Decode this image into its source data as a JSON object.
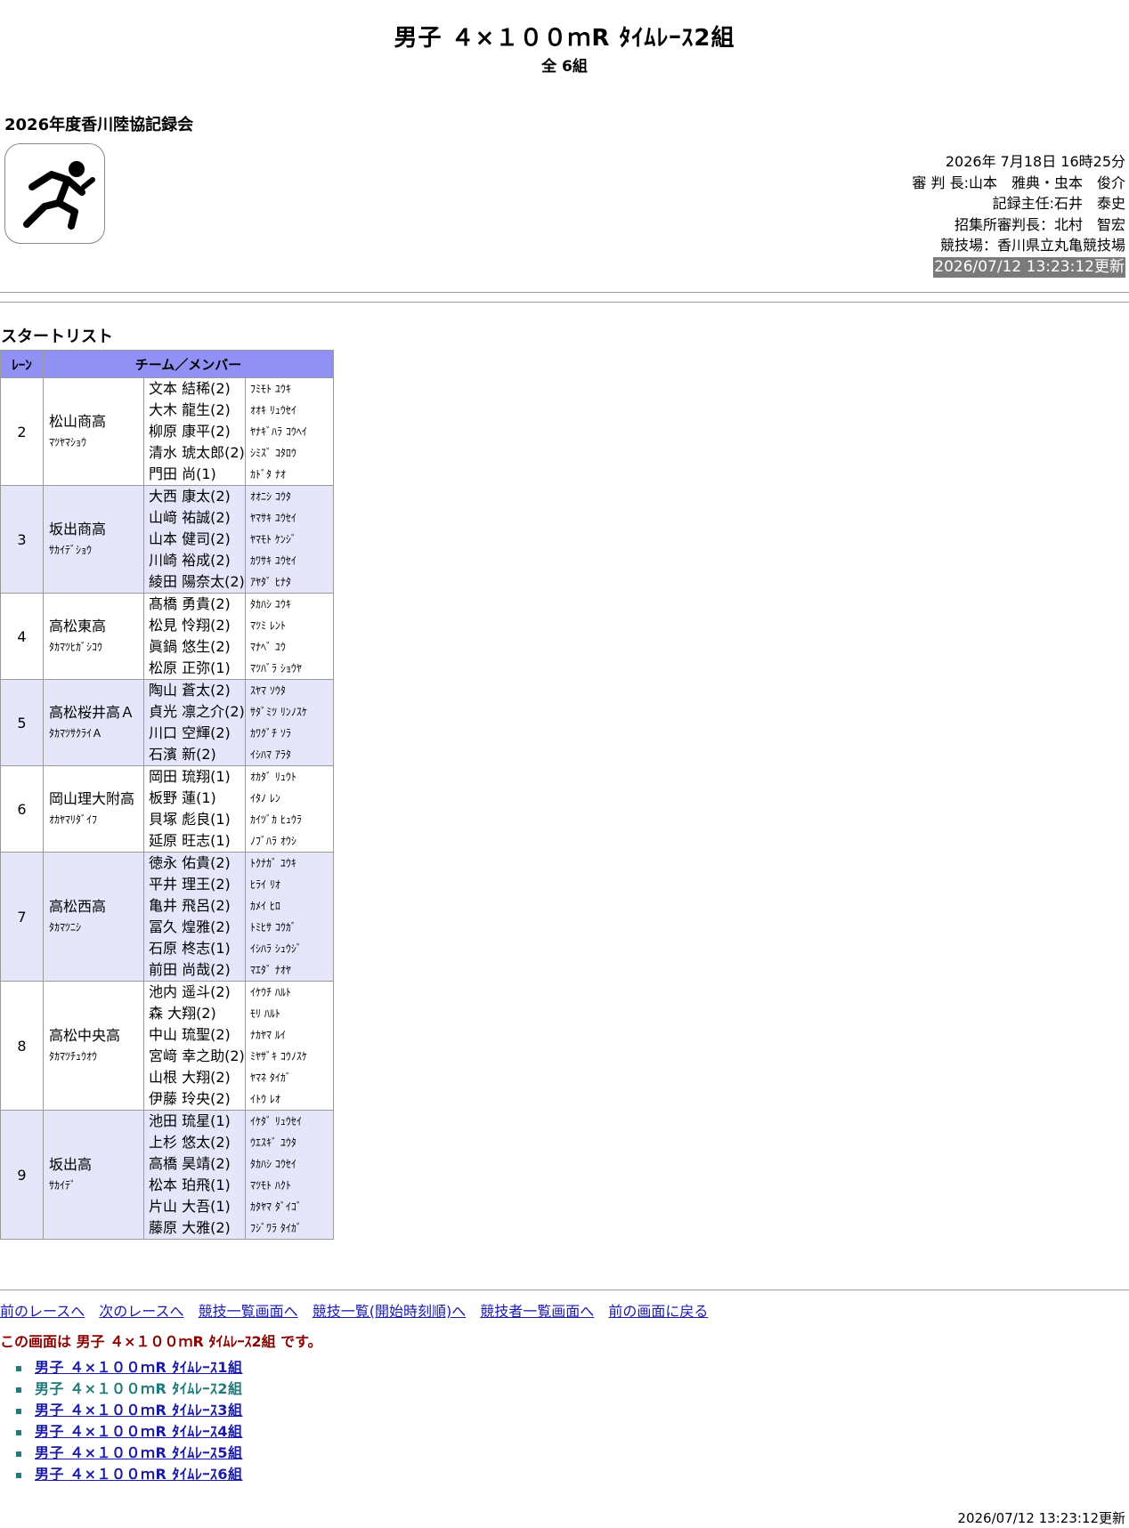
{
  "header": {
    "title": "男子 ４×１００ｍR ﾀｲﾑﾚｰｽ2組",
    "subtitle": "全 6組",
    "meet_name": "2026年度香川陸協記録会",
    "logo_icon": "runner-icon"
  },
  "info": {
    "datetime": "2026年 7月18日 16時25分",
    "referee": "審 判 長:山本　雅典・虫本　俊介",
    "recorder": "記録主任:石井　泰史",
    "call_room": "招集所審判長：北村　智宏",
    "venue": "競技場：香川県立丸亀競技場",
    "updated": "2026/07/12 13:23:12更新"
  },
  "section_title": "スタートリスト",
  "table": {
    "headers": [
      "ﾚｰﾝ",
      "チーム／メンバー"
    ],
    "rows": [
      {
        "lane": "2",
        "team": "松山商高",
        "team_kana": "ﾏﾂﾔﾏｼｮｳ",
        "members": [
          "文本 結稀(2)",
          "大木 龍生(2)",
          "柳原 康平(2)",
          "清水 琥太郎(2)",
          "門田 尚(1)"
        ],
        "kanas": [
          "ﾌﾐﾓﾄ ﾕｳｷ",
          "ｵｵｷ ﾘｭｳｾｲ",
          "ﾔﾅｷﾞﾊﾗ ｺｳﾍｲ",
          "ｼﾐｽﾞ ｺﾀﾛｳ",
          "ｶﾄﾞﾀ ﾅｵ"
        ]
      },
      {
        "lane": "3",
        "team": "坂出商高",
        "team_kana": "ｻｶｲﾃﾞｼｮｳ",
        "members": [
          "大西 康太(2)",
          "山﨑 祐誠(2)",
          "山本 健司(2)",
          "川崎 裕成(2)",
          "綾田 陽奈太(2)"
        ],
        "kanas": [
          "ｵｵﾆｼ ｺｳﾀ",
          "ﾔﾏｻｷ ﾕｳｾｲ",
          "ﾔﾏﾓﾄ ｹﾝｼﾞ",
          "ｶﾜｻｷ ﾕｳｾｲ",
          "ｱﾔﾀﾞ ﾋﾅﾀ"
        ]
      },
      {
        "lane": "4",
        "team": "高松東高",
        "team_kana": "ﾀｶﾏﾂﾋｶﾞｼｺｳ",
        "members": [
          "髙橋 勇貴(2)",
          "松見 怜翔(2)",
          "眞鍋 悠生(2)",
          "松原 正弥(1)"
        ],
        "kanas": [
          "ﾀｶﾊｼ ﾕｳｷ",
          "ﾏﾂﾐ ﾚﾝﾄ",
          "ﾏﾅﾍﾞ ﾕｳ",
          "ﾏﾂﾊﾞﾗ ｼｮｳﾔ"
        ]
      },
      {
        "lane": "5",
        "team": "高松桜井高Ａ",
        "team_kana": "ﾀｶﾏﾂｻｸﾗｲＡ",
        "members": [
          "陶山 蒼太(2)",
          "貞光 凛之介(2)",
          "川口 空輝(2)",
          "石濱 新(2)"
        ],
        "kanas": [
          "ｽﾔﾏ ｿｳﾀ",
          "ｻﾀﾞﾐﾂ ﾘﾝﾉｽｹ",
          "ｶﾜｸﾞﾁ ｿﾗ",
          "ｲｼﾊﾏ ｱﾗﾀ"
        ]
      },
      {
        "lane": "6",
        "team": "岡山理大附高",
        "team_kana": "ｵｶﾔﾏﾘﾀﾞｲﾌ",
        "members": [
          "岡田 琉翔(1)",
          "板野 蓮(1)",
          "貝塚 彪良(1)",
          "延原 旺志(1)"
        ],
        "kanas": [
          "ｵｶﾀﾞ ﾘｭｳﾄ",
          "ｲﾀﾉ ﾚﾝ",
          "ｶｲﾂﾞｶ ﾋｭｳﾗ",
          "ﾉﾌﾞﾊﾗ ｵｳｼ"
        ]
      },
      {
        "lane": "7",
        "team": "高松西高",
        "team_kana": "ﾀｶﾏﾂﾆｼ",
        "members": [
          "徳永 佑貴(2)",
          "平井 理王(2)",
          "亀井 飛呂(2)",
          "冨久 煌雅(2)",
          "石原 柊志(1)",
          "前田 尚哉(2)"
        ],
        "kanas": [
          "ﾄｸﾅｶﾞ ﾕｳｷ",
          "ﾋﾗｲ ﾘｵ",
          "ｶﾒｲ ﾋﾛ",
          "ﾄﾐﾋｻ ｺｳｶﾞ",
          "ｲｼﾊﾗ ｼｭｳｼﾞ",
          "ﾏｴﾀﾞ ﾅｵﾔ"
        ]
      },
      {
        "lane": "8",
        "team": "高松中央高",
        "team_kana": "ﾀｶﾏﾂﾁｭｳｵｳ",
        "members": [
          "池内 遥斗(2)",
          "森 大翔(2)",
          "中山 琉聖(2)",
          "宮﨑 幸之助(2)",
          "山根 大翔(2)",
          "伊藤 玲央(2)"
        ],
        "kanas": [
          "ｲｹｳﾁ ﾊﾙﾄ",
          "ﾓﾘ ﾊﾙﾄ",
          "ﾅｶﾔﾏ ﾙｲ",
          "ﾐﾔｻﾞｷ ｺｳﾉｽｹ",
          "ﾔﾏﾈ ﾀｲｶﾞ",
          "ｲﾄｳ ﾚｵ"
        ]
      },
      {
        "lane": "9",
        "team": "坂出高",
        "team_kana": "ｻｶｲﾃﾞ",
        "members": [
          "池田 琉星(1)",
          "上杉 悠太(2)",
          "高橋 昊靖(2)",
          "松本 珀飛(1)",
          "片山 大吾(1)",
          "藤原 大雅(2)"
        ],
        "kanas": [
          "ｲｹﾀﾞ ﾘｭｳｾｲ",
          "ｳｴｽｷﾞ ﾕｳﾀ",
          "ﾀｶﾊｼ ｺｳｾｲ",
          "ﾏﾂﾓﾄ ﾊｸﾄ",
          "ｶﾀﾔﾏ ﾀﾞｲｺﾞ",
          "ﾌｼﾞﾜﾗ ﾀｲｶﾞ"
        ]
      }
    ]
  },
  "nav": {
    "links": [
      "前のレースへ",
      "次のレースへ",
      "競技一覧画面へ",
      "競技一覧(開始時刻順)へ",
      "競技者一覧画面へ",
      "前の画面に戻る"
    ]
  },
  "current_message": "この画面は 男子 ４×１００ｍR ﾀｲﾑﾚｰｽ2組 です。",
  "race_links": [
    "男子 ４×１００ｍR ﾀｲﾑﾚｰｽ1組",
    "男子 ４×１００ｍR ﾀｲﾑﾚｰｽ2組",
    "男子 ４×１００ｍR ﾀｲﾑﾚｰｽ3組",
    "男子 ４×１００ｍR ﾀｲﾑﾚｰｽ4組",
    "男子 ４×１００ｍR ﾀｲﾑﾚｰｽ5組",
    "男子 ４×１００ｍR ﾀｲﾑﾚｰｽ6組"
  ],
  "current_race_index": 1,
  "footer": {
    "updated": "2026/07/12 13:23:12更新"
  },
  "colors": {
    "header_bg": "#9191f5",
    "alt_row_bg": "#e6e6fa",
    "link": "#1a1aa6",
    "current": "#1f7a7a",
    "message": "#8b0000"
  }
}
